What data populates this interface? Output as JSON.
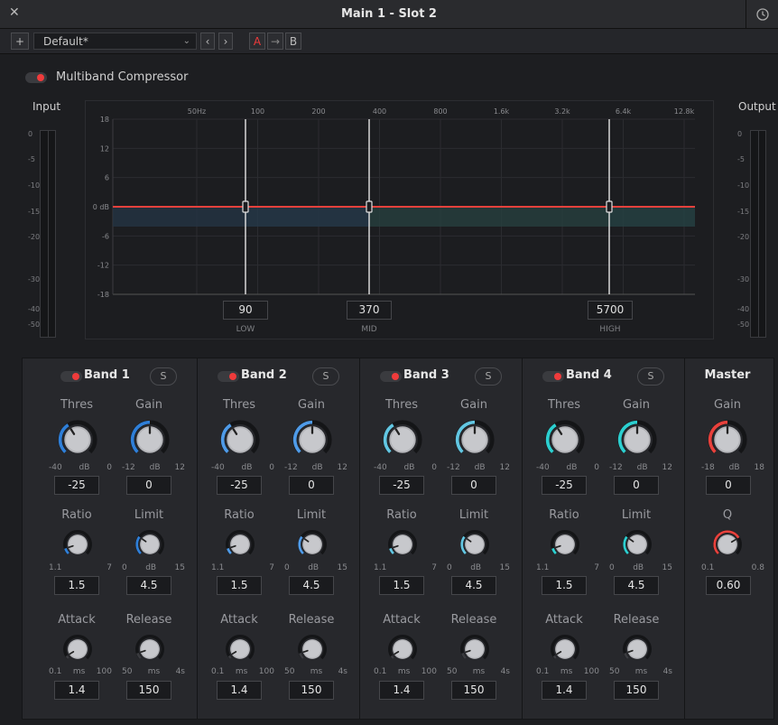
{
  "window": {
    "title": "Main 1 - Slot 2"
  },
  "toolbar": {
    "add": "+",
    "preset": "Default*",
    "prev": "‹",
    "next": "›",
    "ab_a": "A",
    "ab_copy": "→",
    "ab_b": "B"
  },
  "plugin": {
    "name": "Multiband Compressor",
    "enabled": true
  },
  "meters": {
    "input_label": "Input",
    "output_label": "Output",
    "scale": [
      "0",
      "-5",
      "-10",
      "-15",
      "-20",
      "-30",
      "-40",
      "-50"
    ]
  },
  "graph": {
    "y_ticks": [
      "18",
      "12",
      "6",
      "0 dB",
      "-6",
      "-12",
      "-18"
    ],
    "x_ticks": [
      "50Hz",
      "100",
      "200",
      "400",
      "800",
      "1.6k",
      "3.2k",
      "6.4k",
      "12.8k"
    ],
    "crossovers": [
      {
        "value": "90",
        "label": "LOW"
      },
      {
        "value": "370",
        "label": "MID"
      },
      {
        "value": "5700",
        "label": "HIGH"
      }
    ],
    "curve_color": "#e8413c"
  },
  "bands": [
    {
      "name": "Band 1",
      "solo": "S",
      "color": "#2f7fd8",
      "thres": {
        "label": "Thres",
        "min": "-40",
        "unit": "dB",
        "max": "0",
        "value": "-25"
      },
      "gain": {
        "label": "Gain",
        "min": "-12",
        "unit": "dB",
        "max": "12",
        "value": "0"
      },
      "ratio": {
        "label": "Ratio",
        "min": "1.1",
        "unit": "",
        "max": "7",
        "value": "1.5"
      },
      "limit": {
        "label": "Limit",
        "min": "0",
        "unit": "dB",
        "max": "15",
        "value": "4.5"
      },
      "attack": {
        "label": "Attack",
        "min": "0.1",
        "unit": "ms",
        "max": "100",
        "value": "1.4"
      },
      "release": {
        "label": "Release",
        "min": "50",
        "unit": "ms",
        "max": "4s",
        "value": "150"
      }
    },
    {
      "name": "Band 2",
      "solo": "S",
      "color": "#4f9be8",
      "thres": {
        "label": "Thres",
        "min": "-40",
        "unit": "dB",
        "max": "0",
        "value": "-25"
      },
      "gain": {
        "label": "Gain",
        "min": "-12",
        "unit": "dB",
        "max": "12",
        "value": "0"
      },
      "ratio": {
        "label": "Ratio",
        "min": "1.1",
        "unit": "",
        "max": "7",
        "value": "1.5"
      },
      "limit": {
        "label": "Limit",
        "min": "0",
        "unit": "dB",
        "max": "15",
        "value": "4.5"
      },
      "attack": {
        "label": "Attack",
        "min": "0.1",
        "unit": "ms",
        "max": "100",
        "value": "1.4"
      },
      "release": {
        "label": "Release",
        "min": "50",
        "unit": "ms",
        "max": "4s",
        "value": "150"
      }
    },
    {
      "name": "Band 3",
      "solo": "S",
      "color": "#62c6e2",
      "thres": {
        "label": "Thres",
        "min": "-40",
        "unit": "dB",
        "max": "0",
        "value": "-25"
      },
      "gain": {
        "label": "Gain",
        "min": "-12",
        "unit": "dB",
        "max": "12",
        "value": "0"
      },
      "ratio": {
        "label": "Ratio",
        "min": "1.1",
        "unit": "",
        "max": "7",
        "value": "1.5"
      },
      "limit": {
        "label": "Limit",
        "min": "0",
        "unit": "dB",
        "max": "15",
        "value": "4.5"
      },
      "attack": {
        "label": "Attack",
        "min": "0.1",
        "unit": "ms",
        "max": "100",
        "value": "1.4"
      },
      "release": {
        "label": "Release",
        "min": "50",
        "unit": "ms",
        "max": "4s",
        "value": "150"
      }
    },
    {
      "name": "Band 4",
      "solo": "S",
      "color": "#2ccfd0",
      "thres": {
        "label": "Thres",
        "min": "-40",
        "unit": "dB",
        "max": "0",
        "value": "-25"
      },
      "gain": {
        "label": "Gain",
        "min": "-12",
        "unit": "dB",
        "max": "12",
        "value": "0"
      },
      "ratio": {
        "label": "Ratio",
        "min": "1.1",
        "unit": "",
        "max": "7",
        "value": "1.5"
      },
      "limit": {
        "label": "Limit",
        "min": "0",
        "unit": "dB",
        "max": "15",
        "value": "4.5"
      },
      "attack": {
        "label": "Attack",
        "min": "0.1",
        "unit": "ms",
        "max": "100",
        "value": "1.4"
      },
      "release": {
        "label": "Release",
        "min": "50",
        "unit": "ms",
        "max": "4s",
        "value": "150"
      }
    }
  ],
  "master": {
    "name": "Master",
    "color": "#e8413c",
    "gain": {
      "label": "Gain",
      "min": "-18",
      "unit": "dB",
      "max": "18",
      "value": "0"
    },
    "q": {
      "label": "Q",
      "min": "0.1",
      "unit": "",
      "max": "0.8",
      "value": "0.60"
    }
  }
}
